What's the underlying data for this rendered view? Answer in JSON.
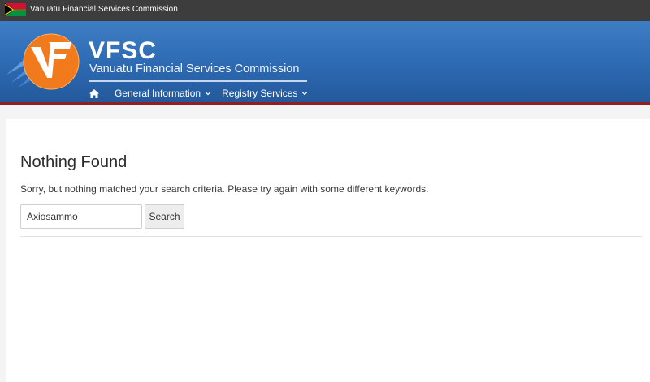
{
  "topbar": {
    "title": "Vanuatu Financial Services Commission",
    "flag_icon": "vanuatu-flag"
  },
  "brand": {
    "acronym": "VFSC",
    "full_name": "Vanuatu Financial Services Commission",
    "logo_icon": "vfsc-logo",
    "colors": {
      "header_blue": "#2f6db6",
      "logo_orange": "#f07a1c",
      "accent_red": "#8e1f24"
    }
  },
  "nav": {
    "home_icon": "home-icon",
    "items": [
      {
        "label": "General Information",
        "icon": "chevron-down-icon"
      },
      {
        "label": "Registry Services",
        "icon": "chevron-down-icon"
      }
    ]
  },
  "main": {
    "title": "Nothing Found",
    "message": "Sorry, but nothing matched your search criteria. Please try again with some different keywords.",
    "search": {
      "value": "Axiosammo",
      "button_label": "Search"
    }
  }
}
